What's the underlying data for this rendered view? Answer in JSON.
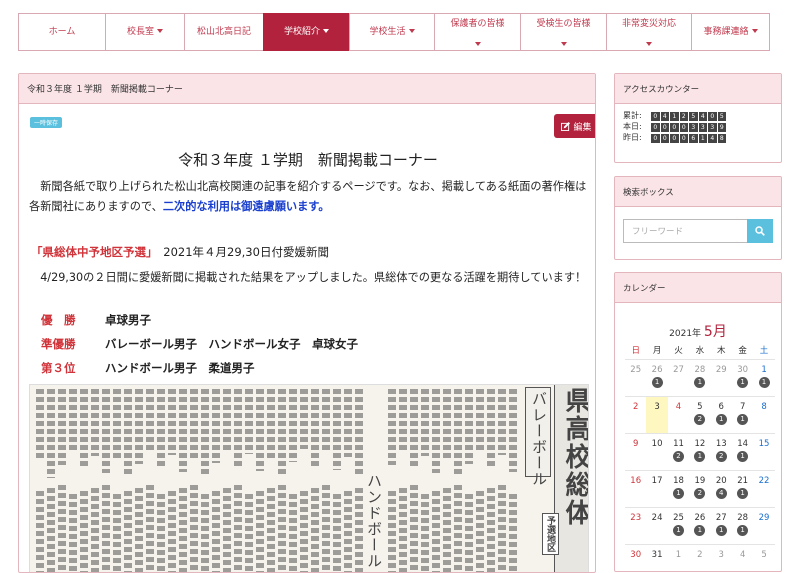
{
  "nav": [
    {
      "label": "ホーム",
      "caret": false,
      "active": false,
      "w": 88
    },
    {
      "label": "校長室",
      "caret": true,
      "active": false,
      "w": 80
    },
    {
      "label": "松山北高日記",
      "caret": false,
      "active": false,
      "w": 80
    },
    {
      "label": "学校紹介",
      "caret": true,
      "active": true,
      "w": 87
    },
    {
      "label": "学校生活",
      "caret": true,
      "active": false,
      "w": 86
    },
    {
      "label": "保護者の皆様",
      "caret": true,
      "active": false,
      "w": 87
    },
    {
      "label": "受検生の皆様",
      "caret": true,
      "active": false,
      "w": 87
    },
    {
      "label": "非常変災対応",
      "caret": true,
      "active": false,
      "w": 86
    },
    {
      "label": "事務課連絡",
      "caret": true,
      "active": false,
      "w": 79
    }
  ],
  "main": {
    "header": "令和３年度 １学期　新聞掲載コーナー",
    "temp_badge": "一時保存",
    "edit_label": "編集",
    "title": "令和３年度 １学期　新聞掲載コーナー",
    "intro_text": "　新聞各紙で取り上げられた松山北高校関連の記事を紹介するページです。なお、掲載してある紙面の著作権は各新聞社にありますので、",
    "intro_emphasis": "二次的な利用は御遠慮願います。",
    "section_title": "「県総体中予地区予選」",
    "section_date": "　2021年４月29,30日付愛媛新聞",
    "section_body": "　4/29,30の２日間に愛媛新聞に掲載された結果をアップしました。県総体での更なる活躍を期待しています！",
    "results": [
      {
        "label": "優　勝",
        "value": "卓球男子"
      },
      {
        "label": "準優勝",
        "value": "バレーボール男子　ハンドボール女子　卓球女子"
      },
      {
        "label": "第３位",
        "value": "ハンドボール男子　柔道男子"
      }
    ],
    "clip_headline": "県高校総体",
    "clip_sub1": "バレーボール",
    "clip_sub2": "ハンドボール",
    "clip_tag": "予選地区"
  },
  "counter": {
    "header": "アクセスカウンター",
    "rows": [
      {
        "label": "累計:",
        "digits": "0412540 5"
      },
      {
        "label": "本日:",
        "digits": "00003339"
      },
      {
        "label": "昨日:",
        "digits": "00006148"
      }
    ]
  },
  "search": {
    "header": "検索ボックス",
    "placeholder": "フリーワード"
  },
  "calendar": {
    "header": "カレンダー",
    "year_label": "2021年",
    "month_label": "5月",
    "weekdays": [
      "日",
      "月",
      "火",
      "水",
      "木",
      "金",
      "土"
    ],
    "weeks": [
      [
        {
          "d": "25",
          "o": true
        },
        {
          "d": "26",
          "o": true,
          "n": "1"
        },
        {
          "d": "27",
          "o": true
        },
        {
          "d": "28",
          "o": true,
          "n": "1"
        },
        {
          "d": "29",
          "o": true
        },
        {
          "d": "30",
          "o": true,
          "n": "1"
        },
        {
          "d": "1",
          "n": "1"
        }
      ],
      [
        {
          "d": "2"
        },
        {
          "d": "3",
          "t": true
        },
        {
          "d": "4"
        },
        {
          "d": "5",
          "n": "2"
        },
        {
          "d": "6",
          "n": "1"
        },
        {
          "d": "7",
          "n": "1"
        },
        {
          "d": "8"
        }
      ],
      [
        {
          "d": "9"
        },
        {
          "d": "10"
        },
        {
          "d": "11",
          "n": "2"
        },
        {
          "d": "12",
          "n": "1"
        },
        {
          "d": "13",
          "n": "2"
        },
        {
          "d": "14",
          "n": "1"
        },
        {
          "d": "15"
        }
      ],
      [
        {
          "d": "16"
        },
        {
          "d": "17"
        },
        {
          "d": "18",
          "n": "1"
        },
        {
          "d": "19",
          "n": "2"
        },
        {
          "d": "20",
          "n": "4"
        },
        {
          "d": "21",
          "n": "1"
        },
        {
          "d": "22"
        }
      ],
      [
        {
          "d": "23"
        },
        {
          "d": "24"
        },
        {
          "d": "25",
          "n": "1"
        },
        {
          "d": "26",
          "n": "1"
        },
        {
          "d": "27",
          "n": "1"
        },
        {
          "d": "28",
          "n": "1"
        },
        {
          "d": "29"
        }
      ],
      [
        {
          "d": "30"
        },
        {
          "d": "31"
        },
        {
          "d": "1",
          "o": true
        },
        {
          "d": "2",
          "o": true
        },
        {
          "d": "3",
          "o": true
        },
        {
          "d": "4",
          "o": true
        },
        {
          "d": "5",
          "o": true
        }
      ]
    ]
  },
  "colors": {
    "accent": "#b2223c",
    "panel_head": "#fbe4e8",
    "info": "#5bc0de",
    "emphasis": "#1a3fcf",
    "red_text": "#d0343a"
  }
}
